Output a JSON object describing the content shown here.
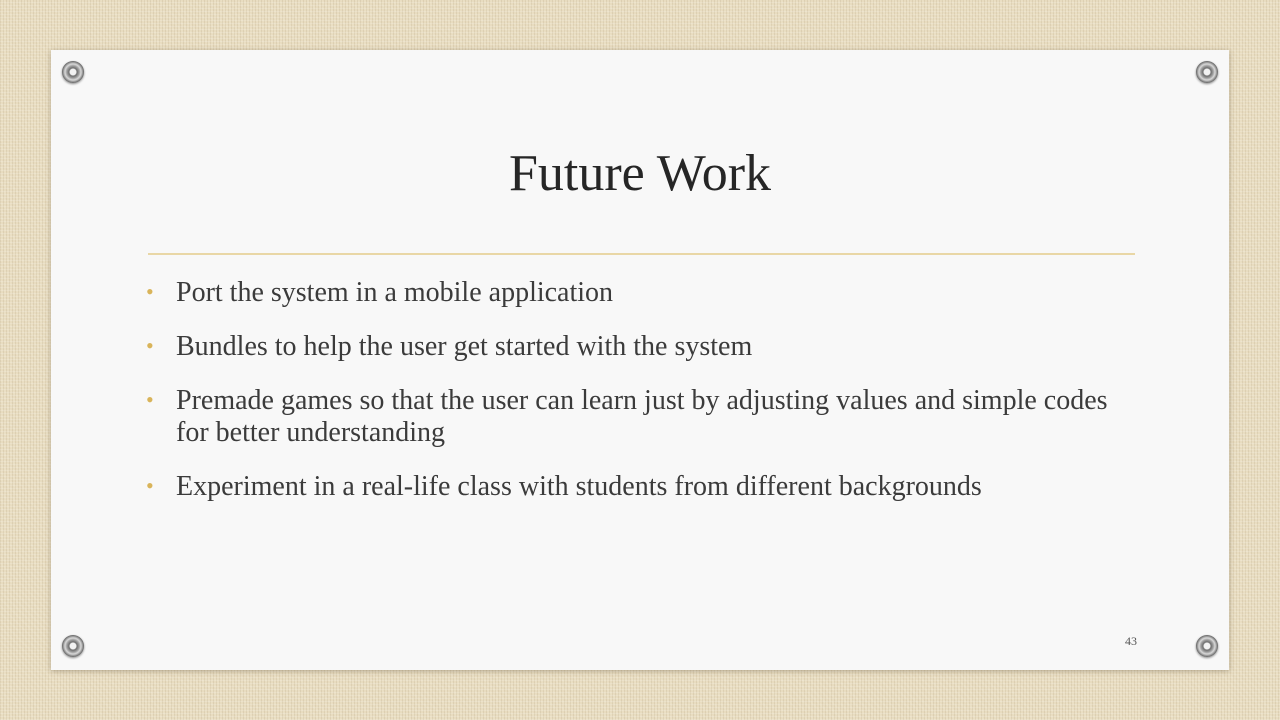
{
  "slide": {
    "title": "Future Work",
    "bullets": [
      "Port the system in a mobile application",
      "Bundles to help the user get started with the system",
      "Premade games so that the user can learn just by adjusting values and simple codes for better understanding",
      "Experiment in a real-life class with students from different backgrounds"
    ],
    "bullet_glyph": "•",
    "page_number": "43"
  },
  "colors": {
    "background": "#e8dcc0",
    "card": "#f8f8f8",
    "accent": "#d9b45a",
    "title_text": "#262626",
    "body_text": "#3b3b3b"
  }
}
